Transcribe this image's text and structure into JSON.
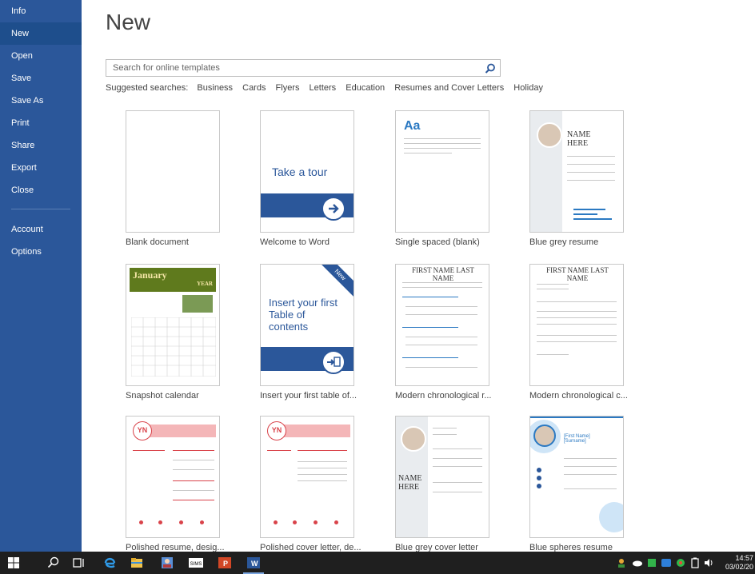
{
  "sidebar": {
    "items": [
      {
        "label": "Info"
      },
      {
        "label": "New",
        "active": true
      },
      {
        "label": "Open"
      },
      {
        "label": "Save"
      },
      {
        "label": "Save As"
      },
      {
        "label": "Print"
      },
      {
        "label": "Share"
      },
      {
        "label": "Export"
      },
      {
        "label": "Close"
      }
    ],
    "bottom_items": [
      {
        "label": "Account"
      },
      {
        "label": "Options"
      }
    ]
  },
  "main": {
    "title": "New",
    "search": {
      "placeholder": "Search for online templates",
      "value": ""
    },
    "suggested_label": "Suggested searches:",
    "suggested": [
      "Business",
      "Cards",
      "Flyers",
      "Letters",
      "Education",
      "Resumes and Cover Letters",
      "Holiday"
    ]
  },
  "templates": [
    {
      "label": "Blank document",
      "kind": "blank"
    },
    {
      "label": "Welcome to Word",
      "kind": "tour",
      "thumb_text": "Take a tour"
    },
    {
      "label": "Single spaced (blank)",
      "kind": "single",
      "thumb_text": "Aa"
    },
    {
      "label": "Blue grey resume",
      "kind": "resume-bg",
      "thumb_text": "NAME HERE"
    },
    {
      "label": "Snapshot calendar",
      "kind": "calendar",
      "thumb_text": "January",
      "thumb_sub": "YEAR"
    },
    {
      "label": "Insert your first table of...",
      "kind": "toc",
      "thumb_text": "Insert your first Table of contents",
      "ribbon": "New"
    },
    {
      "label": "Modern chronological r...",
      "kind": "modern",
      "thumb_text": "FIRST NAME LAST NAME"
    },
    {
      "label": "Modern chronological c...",
      "kind": "modern",
      "thumb_text": "FIRST NAME LAST NAME"
    },
    {
      "label": "Polished resume, desig...",
      "kind": "polished",
      "thumb_text": "YN"
    },
    {
      "label": "Polished cover letter, de...",
      "kind": "polished",
      "thumb_text": "YN"
    },
    {
      "label": "Blue grey cover letter",
      "kind": "resume-bg",
      "thumb_text": "NAME HERE"
    },
    {
      "label": "Blue spheres resume",
      "kind": "spheres",
      "thumb_text": "[First Name] [Surname]"
    }
  ],
  "taskbar": {
    "time": "14:57",
    "date": "03/02/20",
    "apps": [
      "start-icon",
      "search-icon",
      "task-view-icon",
      "edge-icon",
      "file-explorer-icon",
      "contacts-icon",
      "sims-icon",
      "powerpoint-icon",
      "word-icon"
    ]
  },
  "colors": {
    "accent": "#2b579a",
    "accent_dark": "#1e4e8c",
    "taskbar": "#1f1f1f",
    "calendar_green": "#5f7a1d",
    "polished_red": "#d9434a"
  }
}
